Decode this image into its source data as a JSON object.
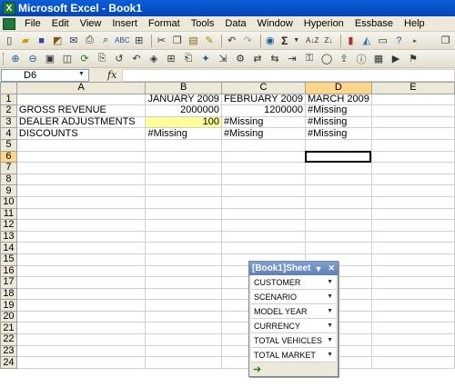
{
  "window": {
    "title": "Microsoft Excel - Book1"
  },
  "menu": [
    "File",
    "Edit",
    "View",
    "Insert",
    "Format",
    "Tools",
    "Data",
    "Window",
    "Hyperion",
    "Essbase",
    "Help"
  ],
  "formula_bar": {
    "name_box": "D6",
    "fx_label": "fx",
    "formula": ""
  },
  "toolbar": {
    "sigma": "Σ",
    "sort_label": "A↓Z"
  },
  "columns": [
    "A",
    "B",
    "C",
    "D",
    "E"
  ],
  "rows": [
    {
      "num": "1",
      "a": "",
      "b": "JANUARY 2009",
      "c": "FEBRUARY 2009",
      "d": "MARCH 2009",
      "e": ""
    },
    {
      "num": "2",
      "a": "GROSS REVENUE",
      "b": "2000000",
      "c": "1200000",
      "d": "#Missing",
      "e": ""
    },
    {
      "num": "3",
      "a": "DEALER ADJUSTMENTS",
      "b": "100",
      "c": "#Missing",
      "d": "#Missing",
      "e": ""
    },
    {
      "num": "4",
      "a": "DISCOUNTS",
      "b": "#Missing",
      "c": "#Missing",
      "d": "#Missing",
      "e": ""
    },
    {
      "num": "5"
    },
    {
      "num": "6"
    },
    {
      "num": "7"
    },
    {
      "num": "8"
    },
    {
      "num": "9"
    },
    {
      "num": "10"
    },
    {
      "num": "11"
    },
    {
      "num": "12"
    },
    {
      "num": "13"
    },
    {
      "num": "14"
    },
    {
      "num": "15"
    },
    {
      "num": "16"
    },
    {
      "num": "17"
    },
    {
      "num": "18"
    },
    {
      "num": "19"
    },
    {
      "num": "20"
    },
    {
      "num": "21"
    },
    {
      "num": "22"
    },
    {
      "num": "23"
    },
    {
      "num": "24"
    }
  ],
  "panel": {
    "title": "[Book1]Sheet",
    "items": [
      "CUSTOMER",
      "SCENARIO",
      "MODEL YEAR",
      "CURRENCY",
      "TOTAL VEHICLES",
      "TOTAL MARKET"
    ]
  },
  "colors": {
    "highlight": "#ffff99",
    "active_header": "#ffd589",
    "title_bar": "#0a5fd8"
  }
}
